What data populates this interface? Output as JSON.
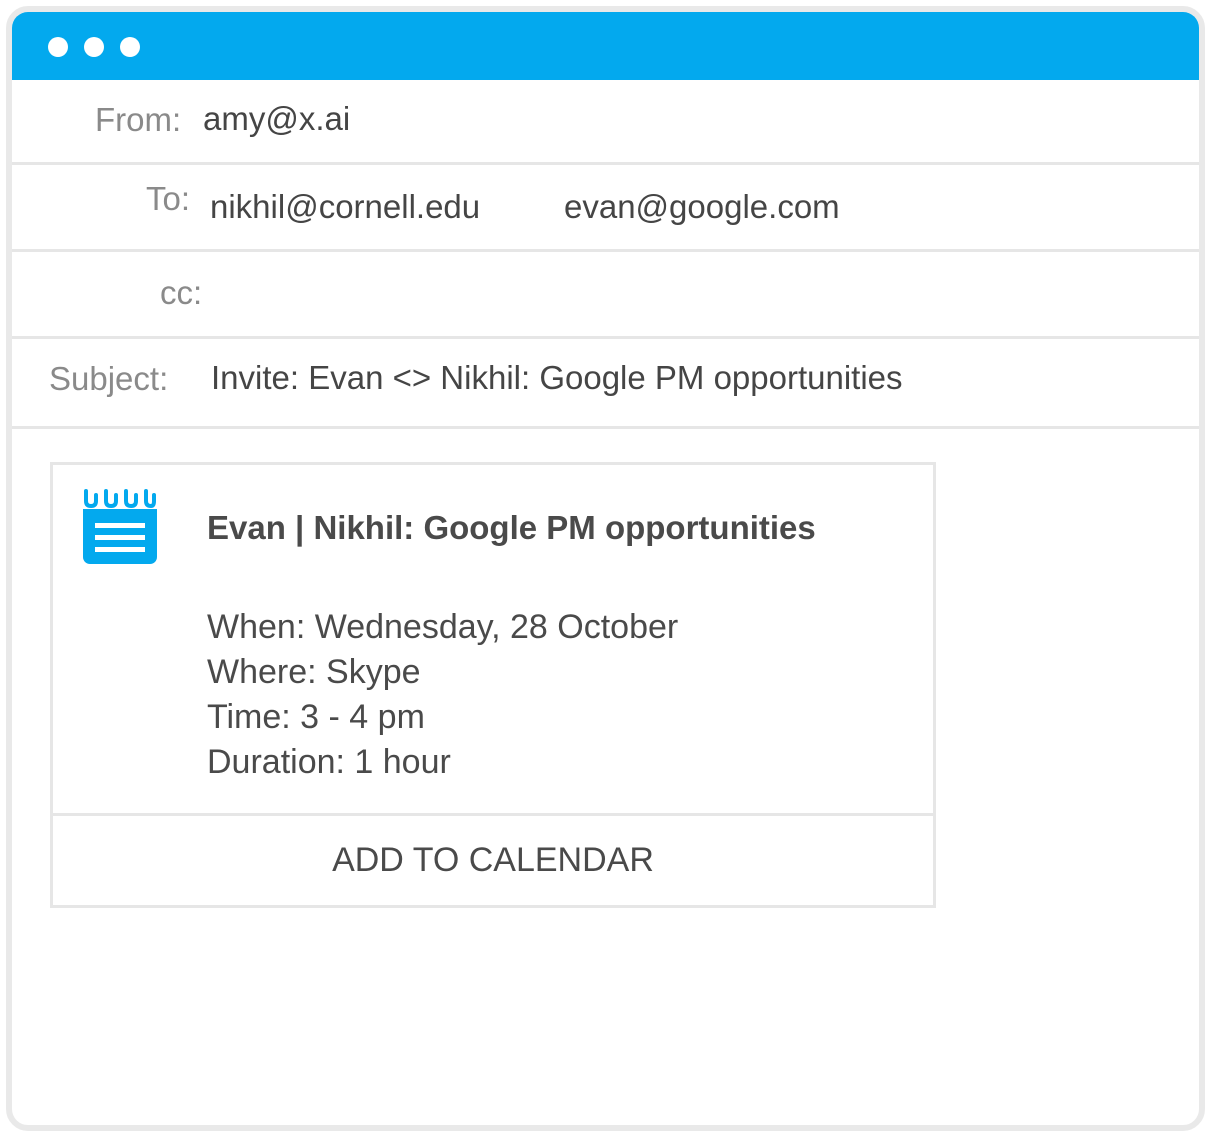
{
  "window": {
    "title_bar_color": "#03a9ee",
    "dots": [
      "dot",
      "dot",
      "dot"
    ]
  },
  "email": {
    "from_label": "From:",
    "from_value": "amy@x.ai",
    "to_label": "To:",
    "to_values": [
      "nikhil@cornell.edu",
      "evan@google.com"
    ],
    "cc_label": "cc:",
    "cc_value": "",
    "subject_label": "Subject:",
    "subject_value": "Invite: Evan <> Nikhil: Google PM opportunities"
  },
  "invite": {
    "icon": "calendar-icon",
    "title": "Evan | Nikhil: Google PM opportunities",
    "details": [
      "When: Wednesday, 28 October",
      "Where: Skype",
      "Time: 3 - 4 pm",
      "Duration: 1 hour"
    ],
    "button_label": "ADD TO CALENDAR"
  }
}
